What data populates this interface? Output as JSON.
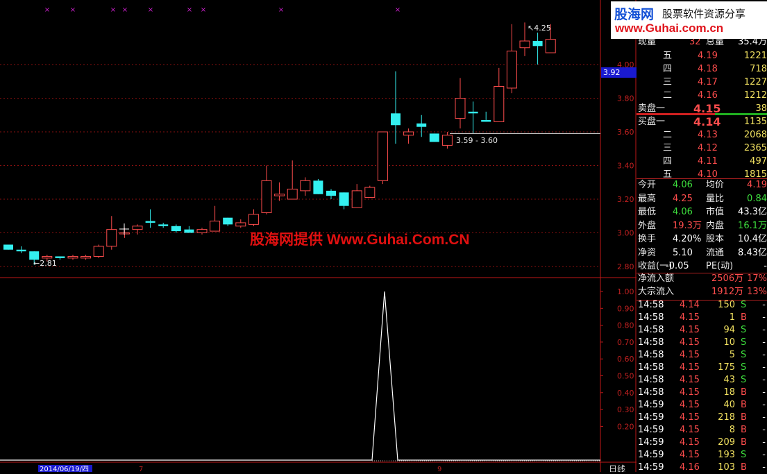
{
  "logo": {
    "brand": "股海网",
    "slogan": "股票软件资源分享",
    "url": "www.Guhai.com.cn"
  },
  "watermark": "股海网提供 Www.Guhai.Com.CN",
  "price_box": "3.92",
  "chart_data": {
    "type": "candlestick",
    "y_ticks": [
      "4.00",
      "3.80",
      "3.60",
      "3.40",
      "3.20",
      "3.00",
      "2.80"
    ],
    "ylim": [
      2.75,
      4.29
    ],
    "candles": [
      {
        "o": 2.93,
        "h": 2.93,
        "l": 2.9,
        "c": 2.9
      },
      {
        "o": 2.9,
        "h": 2.92,
        "l": 2.88,
        "c": 2.89
      },
      {
        "o": 2.89,
        "h": 2.89,
        "l": 2.81,
        "c": 2.84
      },
      {
        "o": 2.85,
        "h": 2.87,
        "l": 2.83,
        "c": 2.86
      },
      {
        "o": 2.86,
        "h": 2.86,
        "l": 2.84,
        "c": 2.85
      },
      {
        "o": 2.85,
        "h": 2.87,
        "l": 2.84,
        "c": 2.86
      },
      {
        "o": 2.85,
        "h": 2.87,
        "l": 2.84,
        "c": 2.86
      },
      {
        "o": 2.86,
        "h": 2.93,
        "l": 2.85,
        "c": 2.92
      },
      {
        "o": 2.92,
        "h": 3.1,
        "l": 2.9,
        "c": 3.02
      },
      {
        "o": 3.0,
        "h": 3.03,
        "l": 2.97,
        "c": 3.0
      },
      {
        "o": 3.02,
        "h": 3.05,
        "l": 2.99,
        "c": 3.04
      },
      {
        "o": 3.07,
        "h": 3.14,
        "l": 3.03,
        "c": 3.06
      },
      {
        "o": 3.05,
        "h": 3.06,
        "l": 3.03,
        "c": 3.04
      },
      {
        "o": 3.04,
        "h": 3.05,
        "l": 3.0,
        "c": 3.01
      },
      {
        "o": 3.02,
        "h": 3.04,
        "l": 3.0,
        "c": 3.0
      },
      {
        "o": 3.0,
        "h": 3.03,
        "l": 2.99,
        "c": 3.02
      },
      {
        "o": 3.01,
        "h": 3.16,
        "l": 3.01,
        "c": 3.07
      },
      {
        "o": 3.09,
        "h": 3.09,
        "l": 3.04,
        "c": 3.05
      },
      {
        "o": 3.04,
        "h": 3.08,
        "l": 3.03,
        "c": 3.06
      },
      {
        "o": 3.05,
        "h": 3.14,
        "l": 3.04,
        "c": 3.11
      },
      {
        "o": 3.12,
        "h": 3.4,
        "l": 3.11,
        "c": 3.31
      },
      {
        "o": 3.22,
        "h": 3.3,
        "l": 3.19,
        "c": 3.23
      },
      {
        "o": 3.2,
        "h": 3.43,
        "l": 3.2,
        "c": 3.26
      },
      {
        "o": 3.25,
        "h": 3.33,
        "l": 3.22,
        "c": 3.31
      },
      {
        "o": 3.31,
        "h": 3.32,
        "l": 3.23,
        "c": 3.23
      },
      {
        "o": 3.25,
        "h": 3.26,
        "l": 3.2,
        "c": 3.22
      },
      {
        "o": 3.24,
        "h": 3.24,
        "l": 3.14,
        "c": 3.16
      },
      {
        "o": 3.15,
        "h": 3.29,
        "l": 3.15,
        "c": 3.25
      },
      {
        "o": 3.21,
        "h": 3.28,
        "l": 3.21,
        "c": 3.27
      },
      {
        "o": 3.31,
        "h": 3.6,
        "l": 3.29,
        "c": 3.6
      },
      {
        "o": 3.71,
        "h": 3.96,
        "l": 3.53,
        "c": 3.64
      },
      {
        "o": 3.58,
        "h": 3.62,
        "l": 3.53,
        "c": 3.6
      },
      {
        "o": 3.65,
        "h": 3.7,
        "l": 3.57,
        "c": 3.63
      },
      {
        "o": 3.59,
        "h": 3.59,
        "l": 3.54,
        "c": 3.54
      },
      {
        "o": 3.52,
        "h": 3.6,
        "l": 3.5,
        "c": 3.58
      },
      {
        "o": 3.68,
        "h": 3.92,
        "l": 3.62,
        "c": 3.8
      },
      {
        "o": 3.72,
        "h": 3.78,
        "l": 3.59,
        "c": 3.71
      },
      {
        "o": 3.67,
        "h": 3.72,
        "l": 3.66,
        "c": 3.66
      },
      {
        "o": 3.66,
        "h": 3.98,
        "l": 3.66,
        "c": 3.87
      },
      {
        "o": 3.86,
        "h": 4.24,
        "l": 3.83,
        "c": 4.08
      },
      {
        "o": 4.1,
        "h": 4.25,
        "l": 4.05,
        "c": 4.14
      },
      {
        "o": 4.14,
        "h": 4.19,
        "l": 4.0,
        "c": 4.11
      },
      {
        "o": 4.07,
        "h": 4.24,
        "l": 4.07,
        "c": 4.15
      }
    ],
    "annotations": {
      "high": "4.25",
      "low": "2.81",
      "range": "3.59 - 3.60"
    },
    "support_level": 3.59,
    "indicator_ticks": [
      "1.00",
      "0.90",
      "0.80",
      "0.70",
      "0.60",
      "0.50",
      "0.40",
      "0.30",
      "0.20"
    ],
    "indicator_peak": 1.0,
    "date_label": "2014/06/19/四",
    "date_tick": "7",
    "date_tick2": "9",
    "period_label": "日线",
    "top_partial_label": "4.00"
  },
  "quote": {
    "header": {
      "label": "现量",
      "value": "32",
      "label2": "总量",
      "value2": "35.4万"
    },
    "asks": [
      {
        "level": "五",
        "price": "4.19",
        "vol": "1221"
      },
      {
        "level": "四",
        "price": "4.18",
        "vol": "718"
      },
      {
        "level": "三",
        "price": "4.17",
        "vol": "1227"
      },
      {
        "level": "二",
        "price": "4.16",
        "vol": "1212"
      },
      {
        "level": "一",
        "price": "4.15",
        "vol": "38"
      }
    ],
    "ask_title": "卖盘",
    "bid_title": "买盘",
    "bids": [
      {
        "level": "一",
        "price": "4.14",
        "vol": "1135"
      },
      {
        "level": "二",
        "price": "4.13",
        "vol": "2068"
      },
      {
        "level": "三",
        "price": "4.12",
        "vol": "2365"
      },
      {
        "level": "四",
        "price": "4.11",
        "vol": "497"
      },
      {
        "level": "五",
        "price": "4.10",
        "vol": "1815"
      }
    ],
    "stats": [
      {
        "l1": "今开",
        "v1": "4.06",
        "c1": "green",
        "l2": "均价",
        "v2": "4.19",
        "c2": "red"
      },
      {
        "l1": "最高",
        "v1": "4.25",
        "c1": "red",
        "l2": "量比",
        "v2": "0.84",
        "c2": "green"
      },
      {
        "l1": "最低",
        "v1": "4.06",
        "c1": "green",
        "l2": "市值",
        "v2": "43.3亿",
        "c2": "white"
      },
      {
        "l1": "外盘",
        "v1": "19.3万",
        "c1": "red",
        "l2": "内盘",
        "v2": "16.1万",
        "c2": "green"
      },
      {
        "l1": "换手",
        "v1": "4.20%",
        "c1": "white",
        "l2": "股本",
        "v2": "10.4亿",
        "c2": "white"
      },
      {
        "l1": "净资",
        "v1": "5.10",
        "c1": "white",
        "l2": "流通",
        "v2": "8.43亿",
        "c2": "white"
      },
      {
        "l1": "收益(一)",
        "v1": "-0.05",
        "c1": "white",
        "l2": "PE(动)",
        "v2": "-",
        "c2": "white"
      }
    ],
    "flow": [
      {
        "label": "净流入额",
        "value": "2506万",
        "pct": "17%"
      },
      {
        "label": "大宗流入",
        "value": "1912万",
        "pct": "13%"
      }
    ],
    "ticks": [
      {
        "t": "14:58",
        "p": "4.14",
        "v": "150",
        "s": "S"
      },
      {
        "t": "14:58",
        "p": "4.15",
        "v": "1",
        "s": "B"
      },
      {
        "t": "14:58",
        "p": "4.15",
        "v": "94",
        "s": "S"
      },
      {
        "t": "14:58",
        "p": "4.15",
        "v": "10",
        "s": "S"
      },
      {
        "t": "14:58",
        "p": "4.15",
        "v": "5",
        "s": "S"
      },
      {
        "t": "14:58",
        "p": "4.15",
        "v": "175",
        "s": "S"
      },
      {
        "t": "14:58",
        "p": "4.15",
        "v": "43",
        "s": "S"
      },
      {
        "t": "14:58",
        "p": "4.15",
        "v": "18",
        "s": "B"
      },
      {
        "t": "14:59",
        "p": "4.15",
        "v": "40",
        "s": "B"
      },
      {
        "t": "14:59",
        "p": "4.15",
        "v": "218",
        "s": "B"
      },
      {
        "t": "14:59",
        "p": "4.15",
        "v": "8",
        "s": "B"
      },
      {
        "t": "14:59",
        "p": "4.15",
        "v": "209",
        "s": "B"
      },
      {
        "t": "14:59",
        "p": "4.15",
        "v": "193",
        "s": "S"
      },
      {
        "t": "14:59",
        "p": "4.16",
        "v": "103",
        "s": "B"
      }
    ],
    "tick_dash": "-"
  },
  "colors": {
    "up": "#ff4d4d",
    "down": "#33f0f0",
    "grid": "#8a1010",
    "axis": "#c01818"
  }
}
